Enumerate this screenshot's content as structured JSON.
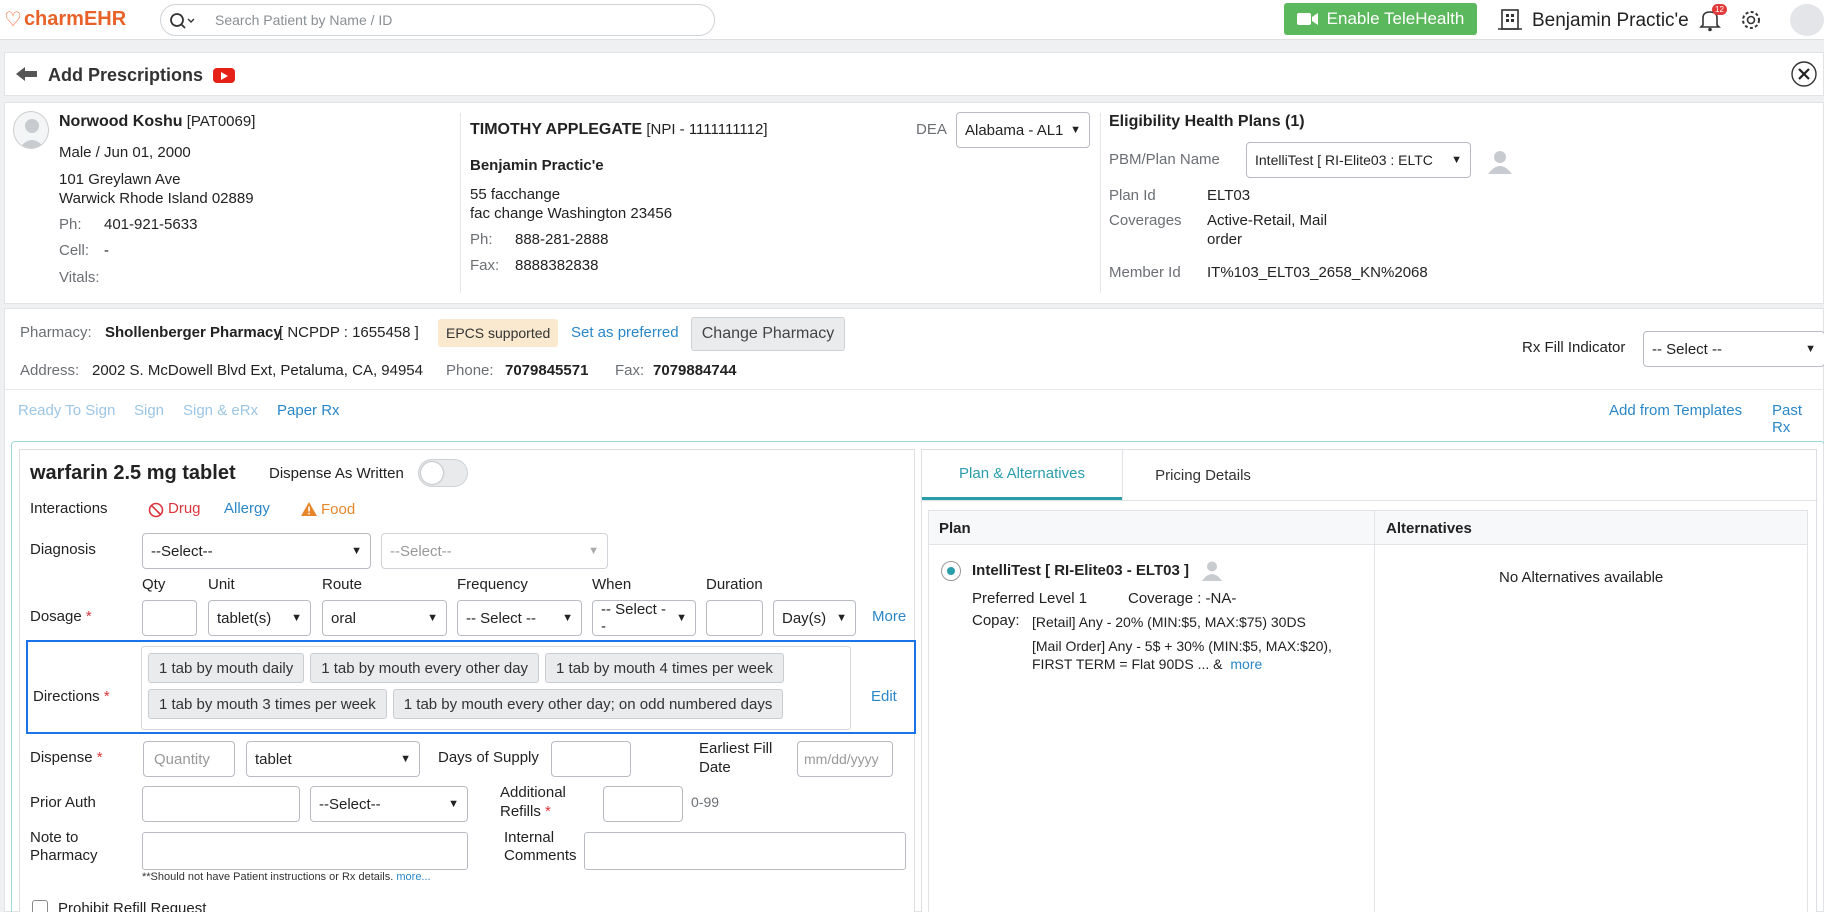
{
  "topbar": {
    "logo_text": "charmEHR",
    "search_placeholder": "Search Patient by Name / ID",
    "telehealth_label": "Enable TeleHealth",
    "practice_name": "Benjamin Practic'e",
    "notification_count": "12"
  },
  "page": {
    "title": "Add Prescriptions"
  },
  "patient": {
    "name": "Norwood Koshu",
    "id": "[PAT0069]",
    "gender_dob": "Male / Jun 01, 2000",
    "address1": "101 Greylawn Ave",
    "address2": "Warwick Rhode Island 02889",
    "ph_label": "Ph:",
    "ph": "401-921-5633",
    "cell_label": "Cell:",
    "cell": "-",
    "vitals_label": "Vitals:"
  },
  "provider": {
    "name": "TIMOTHY APPLEGATE",
    "npi": "[NPI - 1111111112]",
    "dea_label": "DEA",
    "dea_value": "Alabama - AL1",
    "practice": "Benjamin Practic'e",
    "address1": "55 facchange",
    "address2": "fac change Washington 23456",
    "ph_label": "Ph:",
    "ph": "888-281-2888",
    "fax_label": "Fax:",
    "fax": "8888382838"
  },
  "eligibility": {
    "title": "Eligibility Health Plans (1)",
    "pbm_label": "PBM/Plan Name",
    "pbm_value": "IntelliTest [ RI-Elite03 : ELTC",
    "plan_id_label": "Plan Id",
    "plan_id": "ELT03",
    "coverages_label": "Coverages",
    "coverages_line1": "Active-Retail, Mail",
    "coverages_line2": "order",
    "member_id_label": "Member Id",
    "member_id": "IT%103_ELT03_2658_KN%2068"
  },
  "pharmacy": {
    "label": "Pharmacy:",
    "name": "Shollenberger Pharmacy",
    "ncpdp": "[ NCPDP : 1655458 ]",
    "epcs": "EPCS supported",
    "set_preferred": "Set as preferred",
    "change": "Change Pharmacy",
    "address_label": "Address:",
    "address": "2002 S. McDowell Blvd Ext, Petaluma, CA, 94954",
    "phone_label": "Phone:",
    "phone": "7079845571",
    "fax_label": "Fax:",
    "fax": "7079884744",
    "rx_fill_label": "Rx Fill Indicator",
    "rx_fill_value": "-- Select --"
  },
  "actions": {
    "ready_to_sign": "Ready To Sign",
    "sign": "Sign",
    "sign_erx": "Sign & eRx",
    "paper_rx": "Paper Rx",
    "add_from_templates": "Add from Templates",
    "past_rx": "Past Rx"
  },
  "drug": {
    "name": "warfarin 2.5 mg tablet",
    "daw_label": "Dispense As Written",
    "interactions_label": "Interactions",
    "int_drug": "Drug",
    "int_allergy": "Allergy",
    "int_food": "Food",
    "diagnosis_label": "Diagnosis",
    "diagnosis1": "--Select--",
    "diagnosis2": "--Select--",
    "dosage_label": "Dosage",
    "qty_label": "Qty",
    "unit_label": "Unit",
    "unit_value": "tablet(s)",
    "route_label": "Route",
    "route_value": "oral",
    "frequency_label": "Frequency",
    "frequency_value": "-- Select --",
    "when_label": "When",
    "when_value": "-- Select --",
    "duration_label": "Duration",
    "duration_unit": "Day(s)",
    "more": "More",
    "directions_label": "Directions",
    "directions": [
      "1 tab by mouth daily",
      "1 tab by mouth every other day",
      "1 tab by mouth 4 times per week",
      "1 tab by mouth 3 times per week",
      "1 tab by mouth every other day; on odd numbered days"
    ],
    "edit": "Edit",
    "dispense_label": "Dispense",
    "dispense_placeholder": "Quantity",
    "dispense_unit": "tablet",
    "days_supply_label": "Days of Supply",
    "earliest_fill_line1": "Earliest Fill",
    "earliest_fill_line2": "Date",
    "date_placeholder": "mm/dd/yyyy",
    "prior_auth_label": "Prior Auth",
    "prior_auth_select": "--Select--",
    "additional_refills_line1": "Additional",
    "additional_refills_line2": "Refills",
    "refills_range": "0-99",
    "note_label_line1": "Note to",
    "note_label_line2": "Pharmacy",
    "internal_line1": "Internal",
    "internal_line2": "Comments",
    "note_hint": "**Should not have Patient instructions or Rx details.",
    "note_hint_more": "more...",
    "prohibit_refill": "Prohibit Refill Request"
  },
  "plan_panel": {
    "tab_plan": "Plan & Alternatives",
    "tab_pricing": "Pricing Details",
    "col_plan": "Plan",
    "col_alternatives": "Alternatives",
    "plan_name": "IntelliTest [ RI-Elite03 - ELT03 ]",
    "preferred_level": "Preferred Level 1",
    "coverage": "Coverage : -NA-",
    "copay_label": "Copay:",
    "copay_retail": "[Retail] Any - 20% (MIN:$5, MAX:$75) 30DS",
    "copay_mail_line1": "[Mail Order] Any - 5$ + 30% (MIN:$5, MAX:$20),",
    "copay_mail_line2": "FIRST TERM = Flat 90DS ... &",
    "copay_more": "more",
    "no_alternatives": "No Alternatives available"
  },
  "colors": {
    "brand": "#e8622a",
    "telehealth": "#5cb85c",
    "link": "#2a87c8",
    "teal": "#2a9dab",
    "highlight_border": "#1a73e8"
  }
}
